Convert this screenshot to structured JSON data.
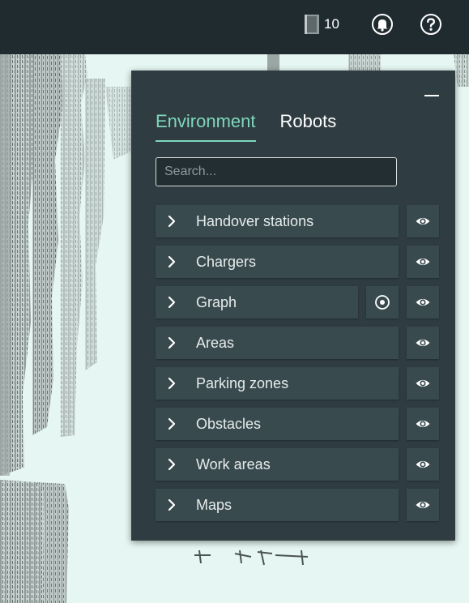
{
  "topbar": {
    "robot_count": "10"
  },
  "panel": {
    "tabs": [
      {
        "label": "Environment",
        "active": true
      },
      {
        "label": "Robots",
        "active": false
      }
    ],
    "search": {
      "placeholder": "Search...",
      "value": ""
    },
    "layers": [
      {
        "label": "Handover stations"
      },
      {
        "label": "Chargers"
      },
      {
        "label": "Graph"
      },
      {
        "label": "Areas"
      },
      {
        "label": "Parking zones"
      },
      {
        "label": "Obstacles"
      },
      {
        "label": "Work areas"
      },
      {
        "label": "Maps"
      }
    ]
  },
  "colors": {
    "topbar_bg": "#1f2b2f",
    "panel_bg": "#2f3d42",
    "row_bg": "#394a4f",
    "accent": "#7fd6bd",
    "map_bg": "#e6f6f2"
  }
}
